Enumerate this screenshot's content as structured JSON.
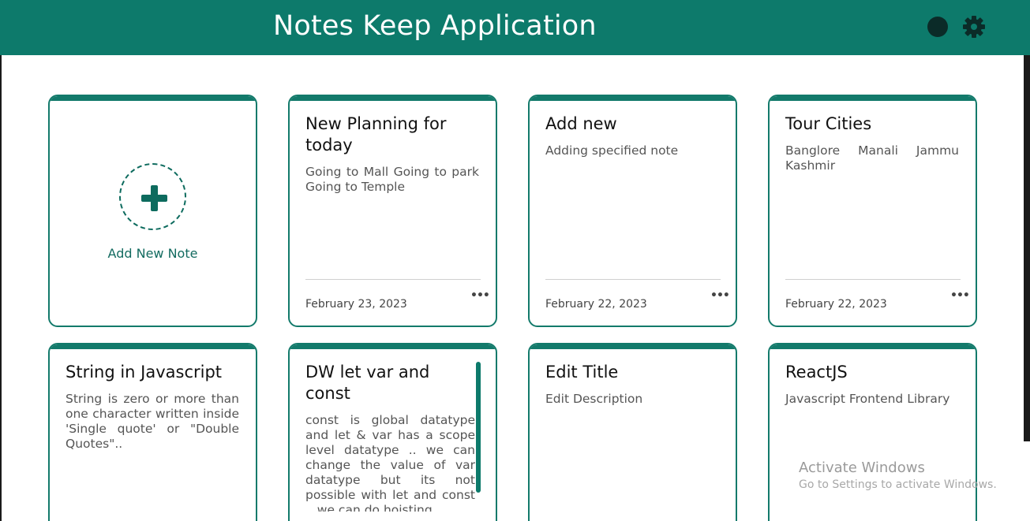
{
  "header": {
    "title": "Notes Keep Application",
    "theme_toggle_icon": "dark-mode-icon",
    "settings_icon": "gear-icon",
    "background_color": "#0d7a6b"
  },
  "add_card": {
    "icon": "plus-icon",
    "label": "Add New Note"
  },
  "notes": [
    {
      "title": "New Planning for today",
      "description": "Going to Mall Going to park Going to Temple",
      "date": "February 23, 2023",
      "menu_icon": "more-icon"
    },
    {
      "title": "Add new",
      "description": "Adding specified note",
      "date": "February 22, 2023",
      "menu_icon": "more-icon"
    },
    {
      "title": "Tour Cities",
      "description": "Banglore Manali Jammu Kashmir",
      "date": "February 22, 2023",
      "menu_icon": "more-icon"
    },
    {
      "title": "String in Javascript",
      "description": "String is zero or more than one character written inside 'Single quote' or \"Double Quotes\".."
    },
    {
      "title": "DW let var and const",
      "description": "const is global datatype and let & var has a scope level datatype .. we can change the value of var datatype but its not possible with let and const .. we can do hoisting"
    },
    {
      "title": "Edit Title",
      "description": "Edit Description"
    },
    {
      "title": "ReactJS",
      "description": "Javascript Frontend Library"
    }
  ],
  "watermark": {
    "title": "Activate Windows",
    "subtitle": "Go to Settings to activate Windows."
  }
}
